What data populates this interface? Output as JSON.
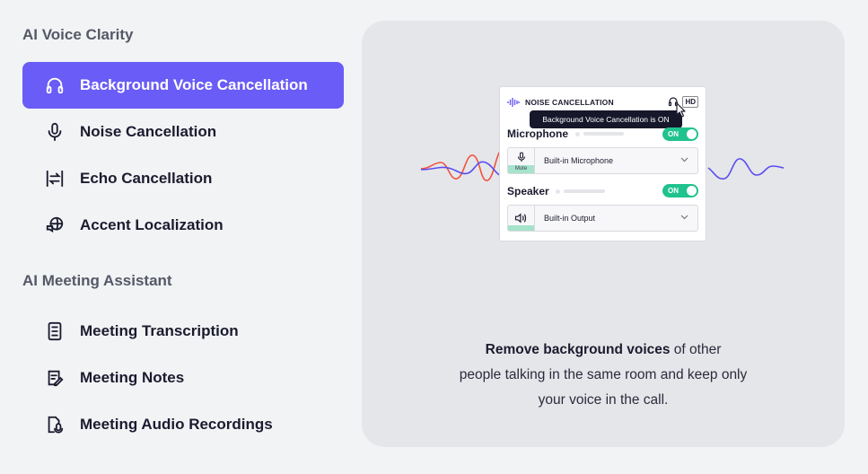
{
  "sections": {
    "voice_clarity": "AI Voice Clarity",
    "meeting_assistant": "AI Meeting Assistant"
  },
  "nav": {
    "background_voice": "Background Voice Cancellation",
    "noise": "Noise Cancellation",
    "echo": "Echo Cancellation",
    "accent": "Accent Localization",
    "transcription": "Meeting Transcription",
    "notes": "Meeting Notes",
    "recordings": "Meeting Audio Recordings"
  },
  "widget": {
    "title": "NOISE CANCELLATION",
    "hd": "HD",
    "tooltip": "Background Voice Cancellation is ON",
    "microphone_label": "Microphone",
    "microphone_toggle": "ON",
    "mic_mute": "Mute",
    "microphone_device": "Built-in Microphone",
    "speaker_label": "Speaker",
    "speaker_toggle": "ON",
    "speaker_device": "Built-in Output"
  },
  "caption": {
    "bold": "Remove background voices",
    "rest1": " of other",
    "line2": "people talking in the same room and keep only",
    "line3": "your voice in the call."
  },
  "colors": {
    "accent": "#6a5cf6",
    "toggle_on": "#20c28e",
    "wave_red": "#f0533f",
    "wave_purple": "#5a4df0"
  }
}
